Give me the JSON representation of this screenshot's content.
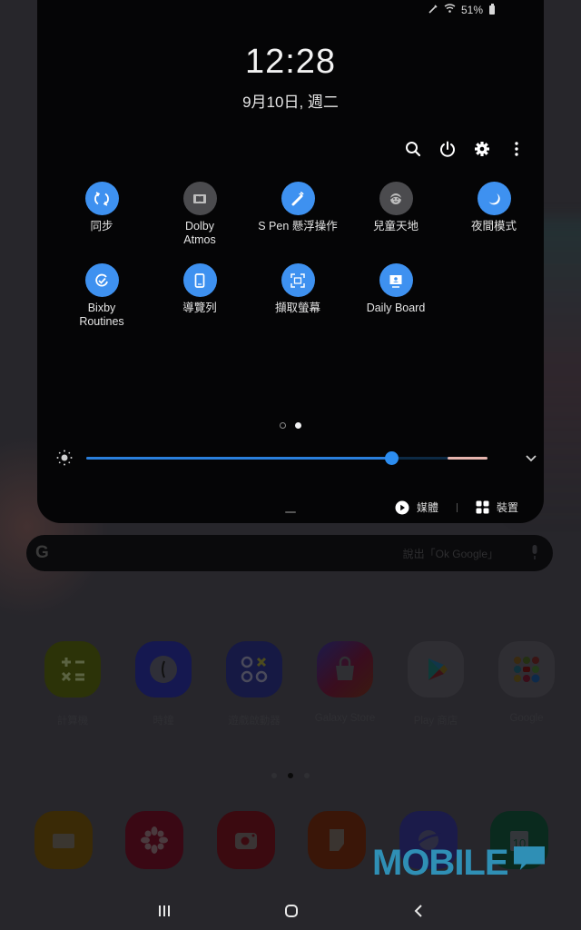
{
  "status_bar": {
    "icons": [
      "s-pen-icon",
      "wifi-icon"
    ],
    "battery_percent": "51%",
    "battery_icon": "battery-icon"
  },
  "quick_panel": {
    "time": "12:28",
    "date": "9月10日, 週二",
    "toolbar": [
      {
        "name": "search",
        "icon": "search-icon"
      },
      {
        "name": "power",
        "icon": "power-icon"
      },
      {
        "name": "settings",
        "icon": "gear-icon"
      },
      {
        "name": "more",
        "icon": "more-vertical-icon"
      }
    ],
    "tiles": [
      {
        "label": "同步",
        "icon": "sync-icon",
        "state": "on"
      },
      {
        "label": "Dolby Atmos",
        "icon": "dolby-icon",
        "state": "off"
      },
      {
        "label": "S Pen 懸浮操作",
        "icon": "s-pen-icon",
        "state": "on"
      },
      {
        "label": "兒童天地",
        "icon": "kids-icon",
        "state": "off"
      },
      {
        "label": "夜間模式",
        "icon": "moon-icon",
        "state": "on"
      },
      {
        "label": "Bixby Routines",
        "icon": "routines-icon",
        "state": "on"
      },
      {
        "label": "導覽列",
        "icon": "navigation-bar-icon",
        "state": "on"
      },
      {
        "label": "擷取螢幕",
        "icon": "screenshot-icon",
        "state": "on"
      },
      {
        "label": "Daily Board",
        "icon": "daily-board-icon",
        "state": "on"
      }
    ],
    "page_indicator": {
      "total": 2,
      "current": 2
    },
    "brightness": {
      "value_percent": 76,
      "icon": "brightness-icon",
      "expand_icon": "chevron-down-icon"
    },
    "bottom_actions": {
      "media_label": "媒體",
      "media_icon": "play-circle-icon",
      "devices_label": "裝置",
      "devices_icon": "grid-icon"
    }
  },
  "home_screen": {
    "search_bar": {
      "logo": "G",
      "hint": "說出「Ok Google」",
      "mic_icon": "mic-icon"
    },
    "apps": [
      {
        "label": "計算機",
        "icon": "calculator-icon",
        "color": "#2c3308"
      },
      {
        "label": "時鐘",
        "icon": "clock-icon",
        "color": "#151850"
      },
      {
        "label": "遊戲啟動器",
        "icon": "game-launcher-icon",
        "color": "#161944"
      },
      {
        "label": "Galaxy Store",
        "icon": "galaxy-store-icon",
        "color": "#3a0d1e"
      },
      {
        "label": "Play 商店",
        "icon": "play-store-icon",
        "color": "#2f2e33"
      },
      {
        "label": "Google",
        "icon": "google-folder-icon",
        "color": "#2f2e33"
      }
    ],
    "page_indicator": {
      "total": 3,
      "current": 2
    },
    "dock": [
      {
        "name": "my-files",
        "icon": "folder-icon",
        "color": "#3a2a06"
      },
      {
        "name": "gallery",
        "icon": "gallery-icon",
        "color": "#3a0814"
      },
      {
        "name": "camera",
        "icon": "camera-icon",
        "color": "#3b0a10"
      },
      {
        "name": "notes",
        "icon": "notes-icon",
        "color": "#3a1608"
      },
      {
        "name": "internet",
        "icon": "internet-icon",
        "color": "#1b1b4a"
      },
      {
        "name": "calendar",
        "icon": "calendar-icon",
        "color": "#0a2a1e",
        "badge_text": "10"
      }
    ]
  },
  "watermark": {
    "text": "MOBILE",
    "color": "#2f8fb5"
  },
  "nav_bar": [
    {
      "name": "recents",
      "icon": "recents-icon"
    },
    {
      "name": "home",
      "icon": "home-icon"
    },
    {
      "name": "back",
      "icon": "back-icon"
    }
  ]
}
